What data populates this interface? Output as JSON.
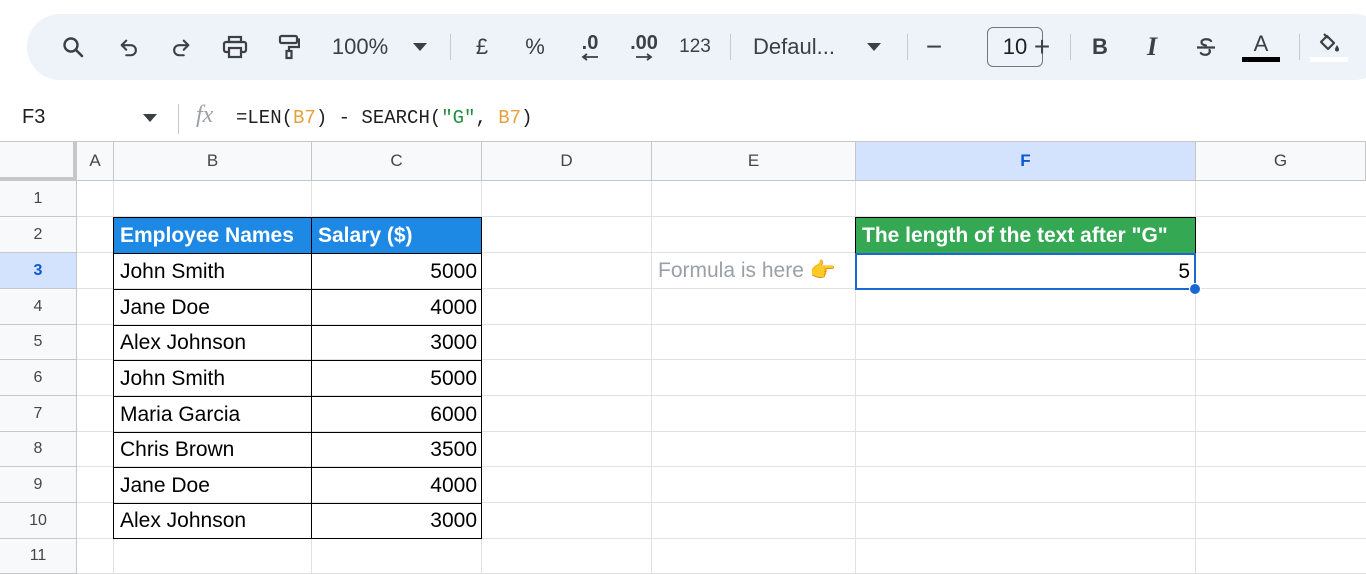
{
  "toolbar": {
    "zoom": "100%",
    "currency": "£",
    "percent": "%",
    "dec_decrease": ".0",
    "dec_increase": ".00",
    "number_format": "123",
    "font_family": "Defaul...",
    "font_size_minus": "−",
    "font_size": "10",
    "font_size_plus": "+",
    "bold": "B",
    "italic": "I",
    "text_color_letter": "A"
  },
  "formula_bar": {
    "cell_ref": "F3",
    "fx": "fx",
    "formula_prefix": "=LEN(",
    "formula_ref1": "B7",
    "formula_mid": ") - SEARCH(",
    "formula_str": "\"G\"",
    "formula_comma": ", ",
    "formula_ref2": "B7",
    "formula_suffix": ")"
  },
  "columns": [
    "A",
    "B",
    "C",
    "D",
    "E",
    "F",
    "G"
  ],
  "rows": [
    "1",
    "2",
    "3",
    "4",
    "5",
    "6",
    "7",
    "8",
    "9",
    "10",
    "11"
  ],
  "table": {
    "header_name": "Employee Names",
    "header_salary": "Salary ($)",
    "rows": [
      {
        "name": "John Smith",
        "salary": "5000"
      },
      {
        "name": "Jane Doe",
        "salary": "4000"
      },
      {
        "name": "Alex Johnson",
        "salary": "3000"
      },
      {
        "name": "John Smith",
        "salary": "5000"
      },
      {
        "name": "Maria Garcia",
        "salary": "6000"
      },
      {
        "name": "Chris Brown",
        "salary": "3500"
      },
      {
        "name": "Jane Doe",
        "salary": "4000"
      },
      {
        "name": "Alex Johnson",
        "salary": "3000"
      }
    ]
  },
  "result": {
    "header": "The length of the text after \"G\"",
    "value": "5",
    "note": "Formula is here 👉"
  },
  "colors": {
    "table_header": "#1e88e5",
    "result_header": "#34a853",
    "selection": "#1a66d2",
    "toolbar_bg": "#eef2f9"
  }
}
